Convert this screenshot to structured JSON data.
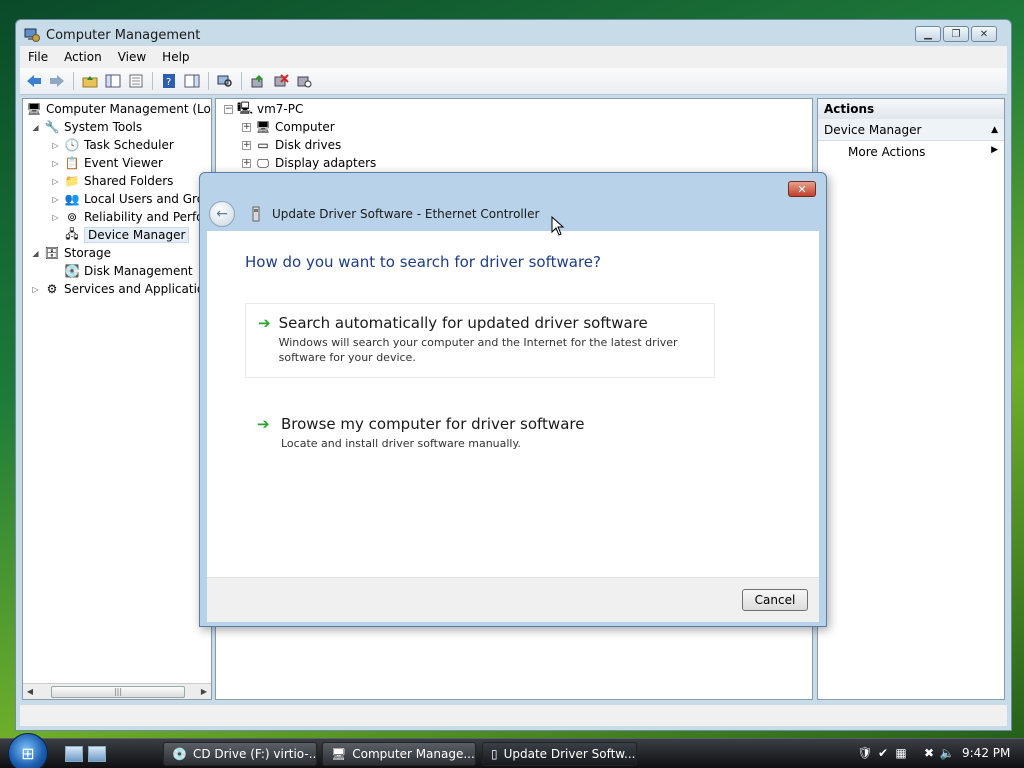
{
  "window": {
    "title": "Computer Management"
  },
  "menu": [
    "File",
    "Action",
    "View",
    "Help"
  ],
  "tree": {
    "root": "Computer Management (Local",
    "system_tools": "System Tools",
    "task_scheduler": "Task Scheduler",
    "event_viewer": "Event Viewer",
    "shared_folders": "Shared Folders",
    "local_users": "Local Users and Group",
    "reliability": "Reliability and Perform",
    "device_manager": "Device Manager",
    "storage": "Storage",
    "disk_management": "Disk Management",
    "services": "Services and Applications"
  },
  "devices": {
    "pc": "vm7-PC",
    "computer": "Computer",
    "disk_drives": "Disk drives",
    "display_adapters": "Display adapters"
  },
  "actions": {
    "header": "Actions",
    "section": "Device Manager",
    "more": "More Actions"
  },
  "dialog": {
    "title": "Update Driver Software - Ethernet Controller",
    "question": "How do you want to search for driver software?",
    "opt1_title": "Search automatically for updated driver software",
    "opt1_desc": "Windows will search your computer and the Internet for the latest driver software for your device.",
    "opt2_title": "Browse my computer for driver software",
    "opt2_desc": "Locate and install driver software manually.",
    "cancel": "Cancel"
  },
  "taskbar": {
    "task1": "CD Drive (F:) virtio-...",
    "task2": "Computer Manage...",
    "task3": "Update Driver Softw...",
    "clock": "9:42 PM"
  },
  "colors": {
    "accent": "#1f3c88",
    "option_arrow": "#2aa52a"
  }
}
